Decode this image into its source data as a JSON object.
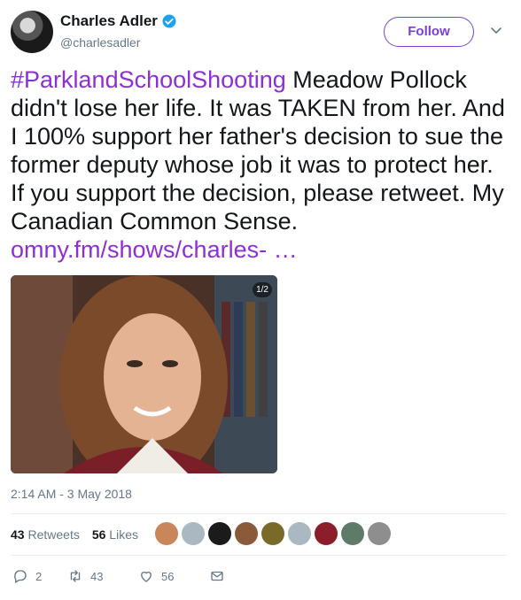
{
  "user": {
    "name": "Charles Adler",
    "handle": "@charlesadler",
    "follow_label": "Follow"
  },
  "tweet": {
    "hashtag": "#ParklandSchoolShooting",
    "body": " Meadow Pollock didn't lose her life. It was TAKEN from her. And I 100% support her father's decision to sue the former deputy whose job it was to protect her. If you support the decision, please retweet. My Canadian Common Sense. ",
    "link": "omny.fm/shows/charles-",
    "ellipsis": " …"
  },
  "media": {
    "counter": "1/2"
  },
  "timestamp": "2:14 AM - 3 May 2018",
  "stats": {
    "retweets": "43",
    "retweets_label": "Retweets",
    "likes": "56",
    "likes_label": "Likes"
  },
  "actions": {
    "replies": "2",
    "retweets": "43",
    "likes": "56"
  },
  "colors": {
    "accent": "#8e2fd6",
    "follow": "#7b3fd6",
    "verified": "#1da1f2"
  },
  "icons": [
    "verified-icon",
    "chevron-down-icon",
    "reply-icon",
    "retweet-icon",
    "heart-icon",
    "message-icon"
  ]
}
